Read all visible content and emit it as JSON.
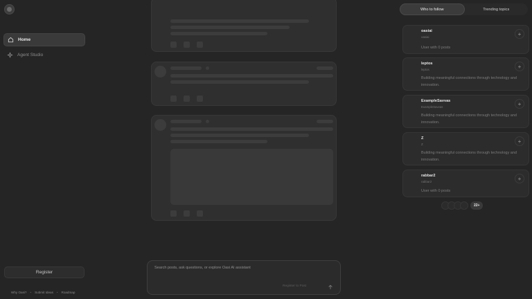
{
  "sidebar": {
    "items": [
      {
        "label": "Home",
        "icon": "home-icon",
        "active": true
      },
      {
        "label": "Agent Studio",
        "icon": "sparkle-icon",
        "active": false
      }
    ],
    "register_label": "Register",
    "footer_links": [
      "Why Oasi?",
      "Submit Ideas",
      "Roadmap"
    ]
  },
  "composer": {
    "placeholder": "Search posts, ask questions, or explore Oasi AI assistant",
    "post_label": "Register to Post",
    "send_icon": "arrow-up-icon"
  },
  "right_panel": {
    "tabs": [
      {
        "label": "Who to follow",
        "active": true
      },
      {
        "label": "Trending topics",
        "active": false
      }
    ],
    "suggestions": [
      {
        "name": "oasiai",
        "handle": "oasiai",
        "bio": "User with 0 posts"
      },
      {
        "name": "leptos",
        "handle": "leptos",
        "bio": "Building meaningful connections through technology and innovation."
      },
      {
        "name": "ExampleSavvas",
        "handle": "ExampleSavvas",
        "bio": "Building meaningful connections through technology and innovation."
      },
      {
        "name": "Z",
        "handle": "Z",
        "bio": "Building meaningful connections through technology and innovation."
      },
      {
        "name": "rabbar2",
        "handle": "rabbar2",
        "bio": "User with 0 posts"
      }
    ],
    "more_count": "22+"
  }
}
